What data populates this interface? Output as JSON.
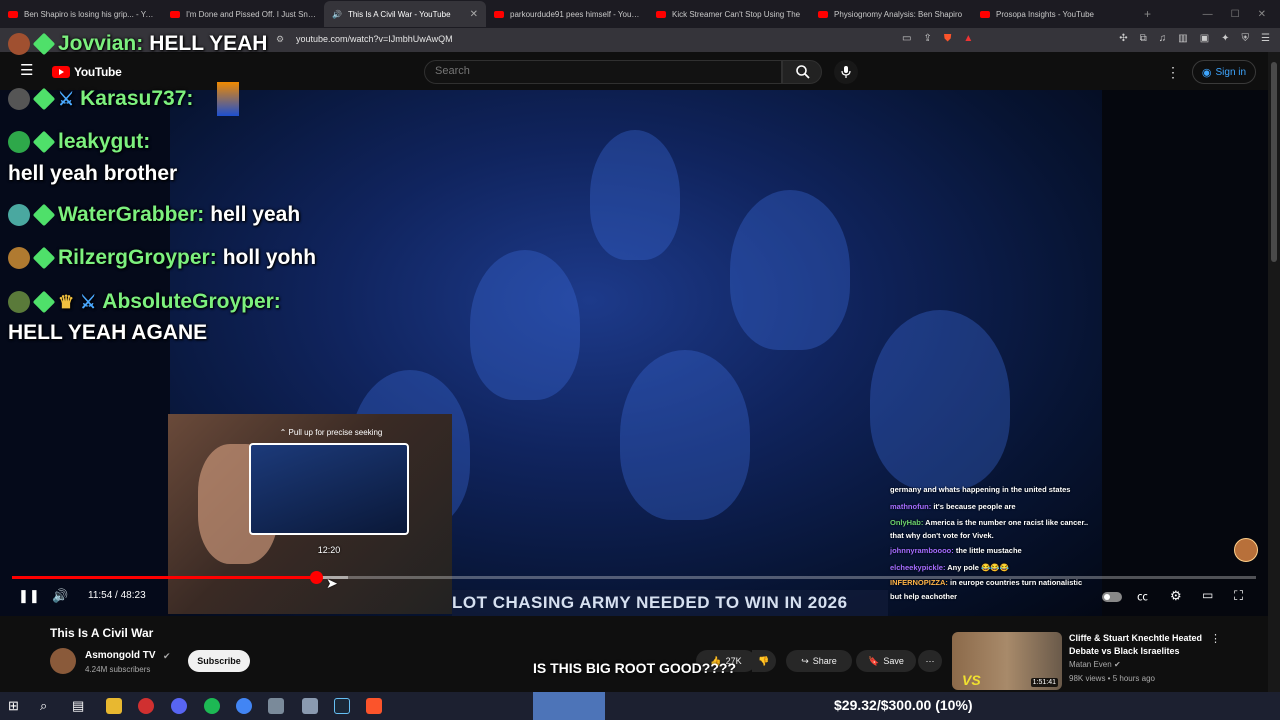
{
  "browser": {
    "tabs": [
      {
        "label": "Ben Shapiro is losing his grip... - You"
      },
      {
        "label": "I'm Done and Pissed Off. I Just Snap"
      },
      {
        "label": "This Is A Civil War - YouTube",
        "active": true
      },
      {
        "label": "parkourdude91 pees himself - YouTu"
      },
      {
        "label": "Kick Streamer Can't Stop Using The"
      },
      {
        "label": "Physiognomy Analysis: Ben Shapiro"
      },
      {
        "label": "Prosopa Insights - YouTube"
      }
    ],
    "url": "youtube.com/watch?v=IJmbhUwAwQM"
  },
  "youtube": {
    "logo_text": "YouTube",
    "search_placeholder": "Search",
    "signin_label": "Sign in"
  },
  "stream_chat": [
    {
      "name": "Jovvian:",
      "message": "HELL YEAH"
    },
    {
      "name": "Karasu737:",
      "message": ""
    },
    {
      "name": "leakygut:",
      "message": "hell yeah brother"
    },
    {
      "name": "WaterGrabber:",
      "message": "hell yeah"
    },
    {
      "name": "RilzergGroyper:",
      "message": "holl yohh"
    },
    {
      "name": "AbsoluteGroyper:",
      "message": "HELL YEAH AGANE"
    }
  ],
  "player": {
    "seek_hint": "Pull up for precise seeking",
    "seek_preview_time": "12:20",
    "current_time": "11:54",
    "duration": "48:23",
    "time_readout": "11:54 / 48:23",
    "progress_fraction": 0.246,
    "buffer_fraction": 0.27,
    "ticker": "LOT CHASING ARMY NEEDED TO WIN IN 2026",
    "caption_overlay": "IS THIS BIG ROOT GOOD????"
  },
  "mini_chat": [
    {
      "name": "",
      "text": "germany and whats happening in the united states"
    },
    {
      "name": "mathnofun:",
      "text": "it's because people are",
      "color": "purple"
    },
    {
      "name": "OnlyHab:",
      "text": "America is the number one racist like cancer..",
      "color": "green"
    },
    {
      "name": "",
      "text": "that why don't vote for Vivek."
    },
    {
      "name": "johnnyramboooo:",
      "text": "the little mustache",
      "color": "purple"
    },
    {
      "name": "elcheekypickle:",
      "text": "Any pole 😂😂😂",
      "color": "purple"
    },
    {
      "name": "INFERNOPIZZA:",
      "text": "in europe countries turn nationalistic",
      "color": "orange"
    },
    {
      "name": "",
      "text": "but help eachother"
    }
  ],
  "video": {
    "title": "This Is A Civil War",
    "channel": "Asmongold TV",
    "subscribers": "4.24M subscribers",
    "subscribe_label": "Subscribe",
    "likes": "27K",
    "share_label": "Share",
    "save_label": "Save"
  },
  "recommended": {
    "title": "Cliffe & Stuart Knechtle Heated Debate vs Black Israelites",
    "channel": "Matan Even",
    "meta": "98K views • 5 hours ago",
    "duration": "1:51:41",
    "thumb_text": "VS"
  },
  "donation": "$29.32/$300.00 (10%)",
  "colors": {
    "accent": "#ff0000",
    "chat_name": "#7cf07e",
    "link": "#3ea6ff"
  }
}
